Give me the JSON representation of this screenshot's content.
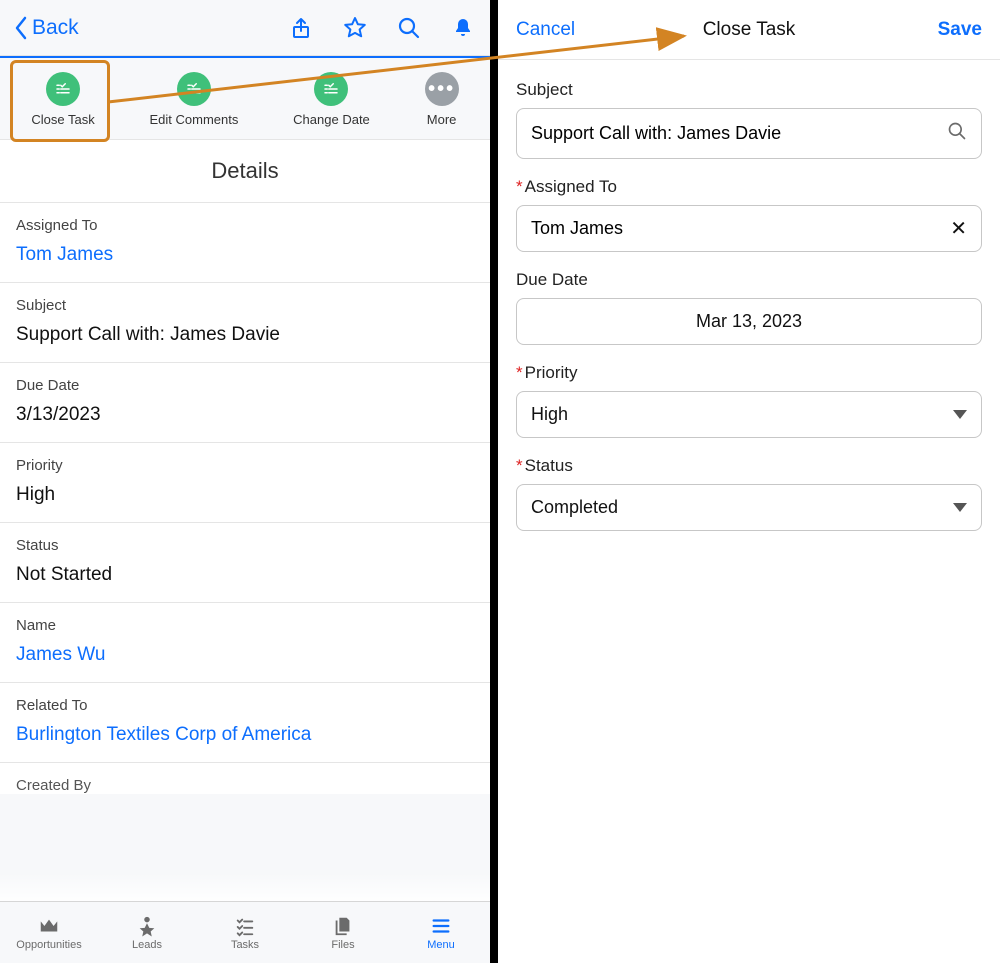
{
  "colors": {
    "accent": "#0d6efd",
    "action_green": "#3fc07a",
    "highlight_border": "#d38423"
  },
  "left": {
    "back_label": "Back",
    "actions": [
      {
        "label": "Close Task",
        "kind": "green",
        "icon": "task-check-icon"
      },
      {
        "label": "Edit Comments",
        "kind": "green",
        "icon": "task-check-icon"
      },
      {
        "label": "Change Date",
        "kind": "green",
        "icon": "task-check-icon"
      },
      {
        "label": "More",
        "kind": "grey",
        "icon": "more-dots-icon"
      }
    ],
    "section_title": "Details",
    "fields": [
      {
        "label": "Assigned To",
        "value": "Tom James",
        "link": true
      },
      {
        "label": "Subject",
        "value": "Support Call with: James Davie"
      },
      {
        "label": "Due Date",
        "value": "3/13/2023"
      },
      {
        "label": "Priority",
        "value": "High"
      },
      {
        "label": "Status",
        "value": "Not Started"
      },
      {
        "label": "Name",
        "value": "James Wu",
        "link": true
      },
      {
        "label": "Related To",
        "value": "Burlington Textiles Corp of America",
        "link": true
      }
    ],
    "cutoff_label": "Created By",
    "tabs": [
      {
        "label": "Opportunities"
      },
      {
        "label": "Leads"
      },
      {
        "label": "Tasks"
      },
      {
        "label": "Files"
      },
      {
        "label": "Menu",
        "active": true
      }
    ]
  },
  "right": {
    "cancel_label": "Cancel",
    "title": "Close Task",
    "save_label": "Save",
    "form": {
      "subject": {
        "label": "Subject",
        "required": false,
        "value": "Support Call with: James Davie",
        "trailing": "search"
      },
      "assigned": {
        "label": "Assigned To",
        "required": true,
        "value": "Tom James",
        "trailing": "clear"
      },
      "due": {
        "label": "Due Date",
        "required": false,
        "value": "Mar 13, 2023",
        "trailing": "none",
        "center": true
      },
      "priority": {
        "label": "Priority",
        "required": true,
        "value": "High",
        "trailing": "caret"
      },
      "status": {
        "label": "Status",
        "required": true,
        "value": "Completed",
        "trailing": "caret"
      }
    }
  }
}
